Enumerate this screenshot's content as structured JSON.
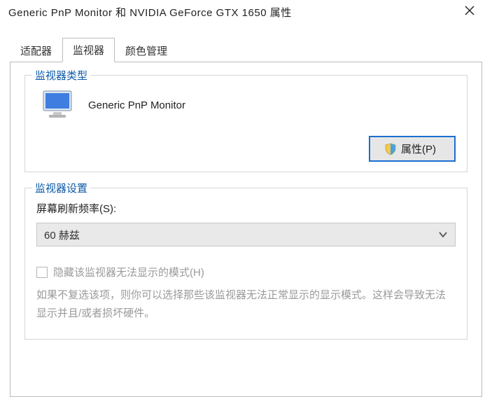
{
  "window": {
    "title": "Generic PnP Monitor 和 NVIDIA GeForce GTX 1650 属性"
  },
  "tabs": {
    "adapter": "适配器",
    "monitor": "监视器",
    "color_mgmt": "颜色管理"
  },
  "group_monitor_type": {
    "legend": "监视器类型",
    "name": "Generic PnP Monitor",
    "properties_button": "属性(P)"
  },
  "group_monitor_settings": {
    "legend": "监视器设置",
    "refresh_label": "屏幕刷新频率(S):",
    "refresh_value": "60 赫兹",
    "hide_modes_checkbox": "隐藏该监视器无法显示的模式(H)",
    "hint": "如果不复选该项，则你可以选择那些该监视器无法正常显示的显示模式。这样会导致无法显示并且/或者损坏硬件。"
  }
}
